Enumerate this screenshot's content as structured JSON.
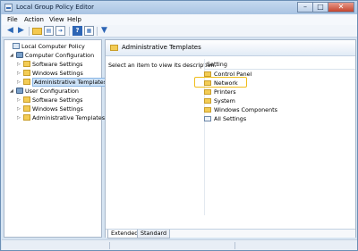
{
  "window": {
    "title": "Local Group Policy Editor",
    "controls": {
      "minimize": "–",
      "maximize": "□",
      "close": "✕"
    }
  },
  "menubar": {
    "items": [
      {
        "label": "File"
      },
      {
        "label": "Action"
      },
      {
        "label": "View"
      },
      {
        "label": "Help"
      }
    ]
  },
  "toolbar": {
    "icons": [
      "back-arrow-icon",
      "forward-arrow-icon",
      "up-folder-icon",
      "show-hide-tree-icon",
      "export-list-icon",
      "help-icon",
      "properties-icon",
      "filter-icon"
    ]
  },
  "tree": {
    "items": [
      {
        "label": "Local Computer Policy",
        "expander": "",
        "icon": "computer-policy-icon"
      },
      {
        "label": "Computer Configuration",
        "expander": "◢",
        "icon": "computer-config-icon"
      },
      {
        "label": "Software Settings",
        "expander": "▷",
        "icon": "folder-icon"
      },
      {
        "label": "Windows Settings",
        "expander": "▷",
        "icon": "folder-icon"
      },
      {
        "label": "Administrative Templates",
        "expander": "▷",
        "icon": "folder-icon",
        "selected": true
      },
      {
        "label": "User Configuration",
        "expander": "◢",
        "icon": "user-config-icon"
      },
      {
        "label": "Software Settings",
        "expander": "▷",
        "icon": "folder-icon"
      },
      {
        "label": "Windows Settings",
        "expander": "▷",
        "icon": "folder-icon"
      },
      {
        "label": "Administrative Templates",
        "expander": "▷",
        "icon": "folder-icon"
      }
    ]
  },
  "right_pane": {
    "title": "Administrative Templates",
    "description": "Select an item to view its description.",
    "column_header": "Setting",
    "settings": [
      {
        "label": "Control Panel",
        "icon": "folder-icon"
      },
      {
        "label": "Network",
        "icon": "folder-icon",
        "highlighted": true
      },
      {
        "label": "Printers",
        "icon": "folder-icon"
      },
      {
        "label": "System",
        "icon": "folder-icon"
      },
      {
        "label": "Windows Components",
        "icon": "folder-icon"
      },
      {
        "label": "All Settings",
        "icon": "all-settings-icon"
      }
    ],
    "tabs": [
      {
        "label": "Extended",
        "active": true
      },
      {
        "label": "Standard",
        "active": false
      }
    ]
  },
  "colors": {
    "highlight_border": "#f0bd1c",
    "selection": "#cde2f7",
    "folder": "#f3cc55"
  }
}
